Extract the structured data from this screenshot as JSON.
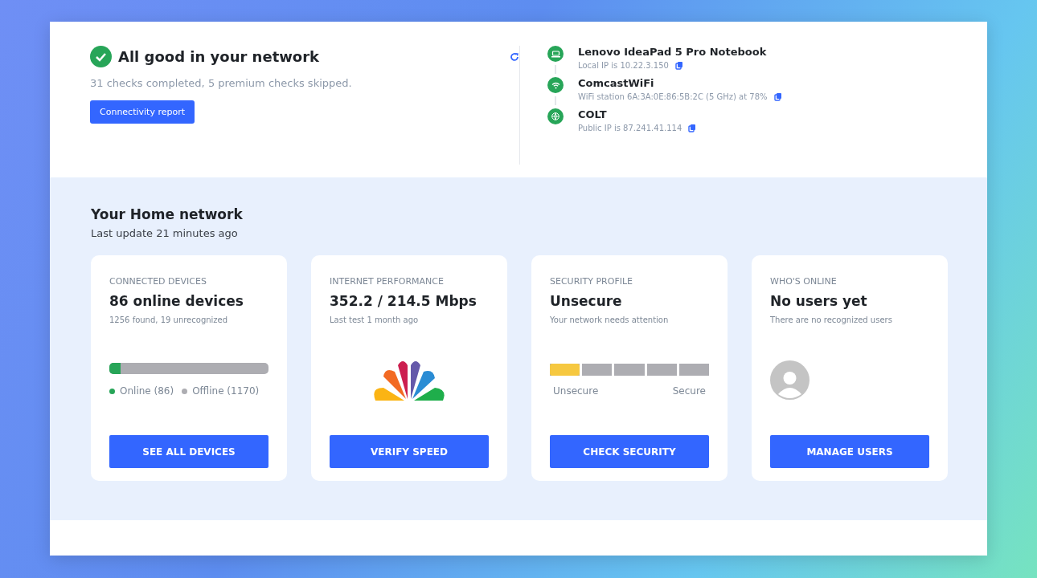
{
  "status": {
    "title": "All good in your network",
    "subtitle": "31 checks completed, 5 premium checks skipped.",
    "button": "Connectivity report"
  },
  "path": [
    {
      "kind": "laptop",
      "name": "Lenovo IdeaPad 5 Pro Notebook",
      "detail": "Local IP is 10.22.3.150"
    },
    {
      "kind": "wifi",
      "name": "ComcastWiFi",
      "detail": "WiFi station 6A:3A:0E:86:5B:2C (5 GHz) at 78%"
    },
    {
      "kind": "globe",
      "name": "COLT",
      "detail": "Public IP is 87.241.41.114"
    }
  ],
  "home": {
    "title": "Your Home network",
    "subtitle": "Last update 21 minutes ago"
  },
  "cards": [
    {
      "kind": "devices",
      "label": "CONNECTED DEVICES",
      "value": "86 online devices",
      "note": "1256 found, 19 unrecognized",
      "level": 0.07,
      "legend": [
        {
          "text": "Online (86)",
          "color": "#27a558"
        },
        {
          "text": "Offline (1170)",
          "color": "#adadb2"
        }
      ],
      "button": "SEE ALL DEVICES"
    },
    {
      "kind": "performance",
      "label": "INTERNET PERFORMANCE",
      "value": "352.2 / 214.5 Mbps",
      "note": "Last test 1 month ago",
      "button": "VERIFY SPEED"
    },
    {
      "kind": "security",
      "label": "SECURITY PROFILE",
      "value": "Unsecure",
      "note": "Your network needs attention",
      "level": 0.2,
      "scale": [
        "Unsecure",
        "Secure"
      ],
      "button": "CHECK SECURITY"
    },
    {
      "kind": "users",
      "label": "WHO'S ONLINE",
      "value": "No users yet",
      "note": "There are no recognized users",
      "button": "MANAGE USERS"
    }
  ]
}
